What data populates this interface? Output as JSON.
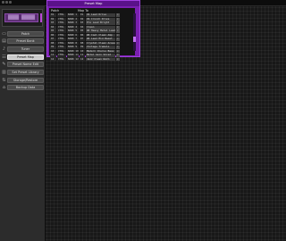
{
  "window_title": "",
  "sidebar": {
    "preset_display": "▒▒▒▒ ▒▒▒▒▒",
    "items": [
      {
        "label": "Patch",
        "icon": "patch-icon",
        "active": false
      },
      {
        "label": "Preset Bank",
        "icon": "bank-icon",
        "active": false
      },
      {
        "label": "Tuner",
        "icon": "tuner-icon",
        "active": false
      },
      {
        "label": "Preset Map",
        "icon": "map-icon",
        "active": true
      },
      {
        "label": "Preset Name Edit",
        "icon": "edit-icon",
        "active": false
      },
      {
        "label": "Set Preset Library",
        "icon": "library-icon",
        "active": false
      },
      {
        "label": "Storage/Restore",
        "icon": "storage-icon",
        "active": false
      },
      {
        "label": "Backup Data",
        "icon": "backup-icon",
        "active": false
      }
    ]
  },
  "dialog": {
    "title": "Preset Map",
    "header_left": "Patch",
    "header_right": "Map To",
    "rows": [
      [
        "01",
        "CTRL",
        "BANK 1",
        "01",
        "US Lead Drive"
      ],
      [
        "02",
        "CTRL",
        "BANK 2",
        "02",
        "US Crunch Drive"
      ],
      [
        "03",
        "CTRL",
        "BANK 3",
        "03",
        "Pro Lead Bright"
      ],
      [
        "04",
        "CTRL",
        "BANK 4",
        "04",
        "Clean"
      ],
      [
        "05",
        "CTRL",
        "BANK 5",
        "05",
        "UK Heavy Metal Lead"
      ],
      [
        "06",
        "CTRL",
        "BANK 6",
        "06",
        "UK Cool Clean Amp"
      ],
      [
        "07",
        "CTRL",
        "BANK 7",
        "07",
        "UK Lead Mid Boost"
      ],
      [
        "08",
        "CTRL",
        "BANK 8",
        "08",
        "Crystal Clean Acoustic"
      ],
      [
        "09",
        "CTRL",
        "BANK 9",
        "09",
        "Vintage Tremolo"
      ],
      [
        "10",
        "CTRL",
        "BANK 10",
        "10",
        "Modern Chorus Bass"
      ],
      [
        "11",
        "CTRL",
        "BANK 11",
        "11",
        "Metal Gain Shred"
      ],
      [
        "12",
        "CTRL",
        "BANK 12",
        "12",
        "Jazz Clean Warm"
      ]
    ]
  }
}
